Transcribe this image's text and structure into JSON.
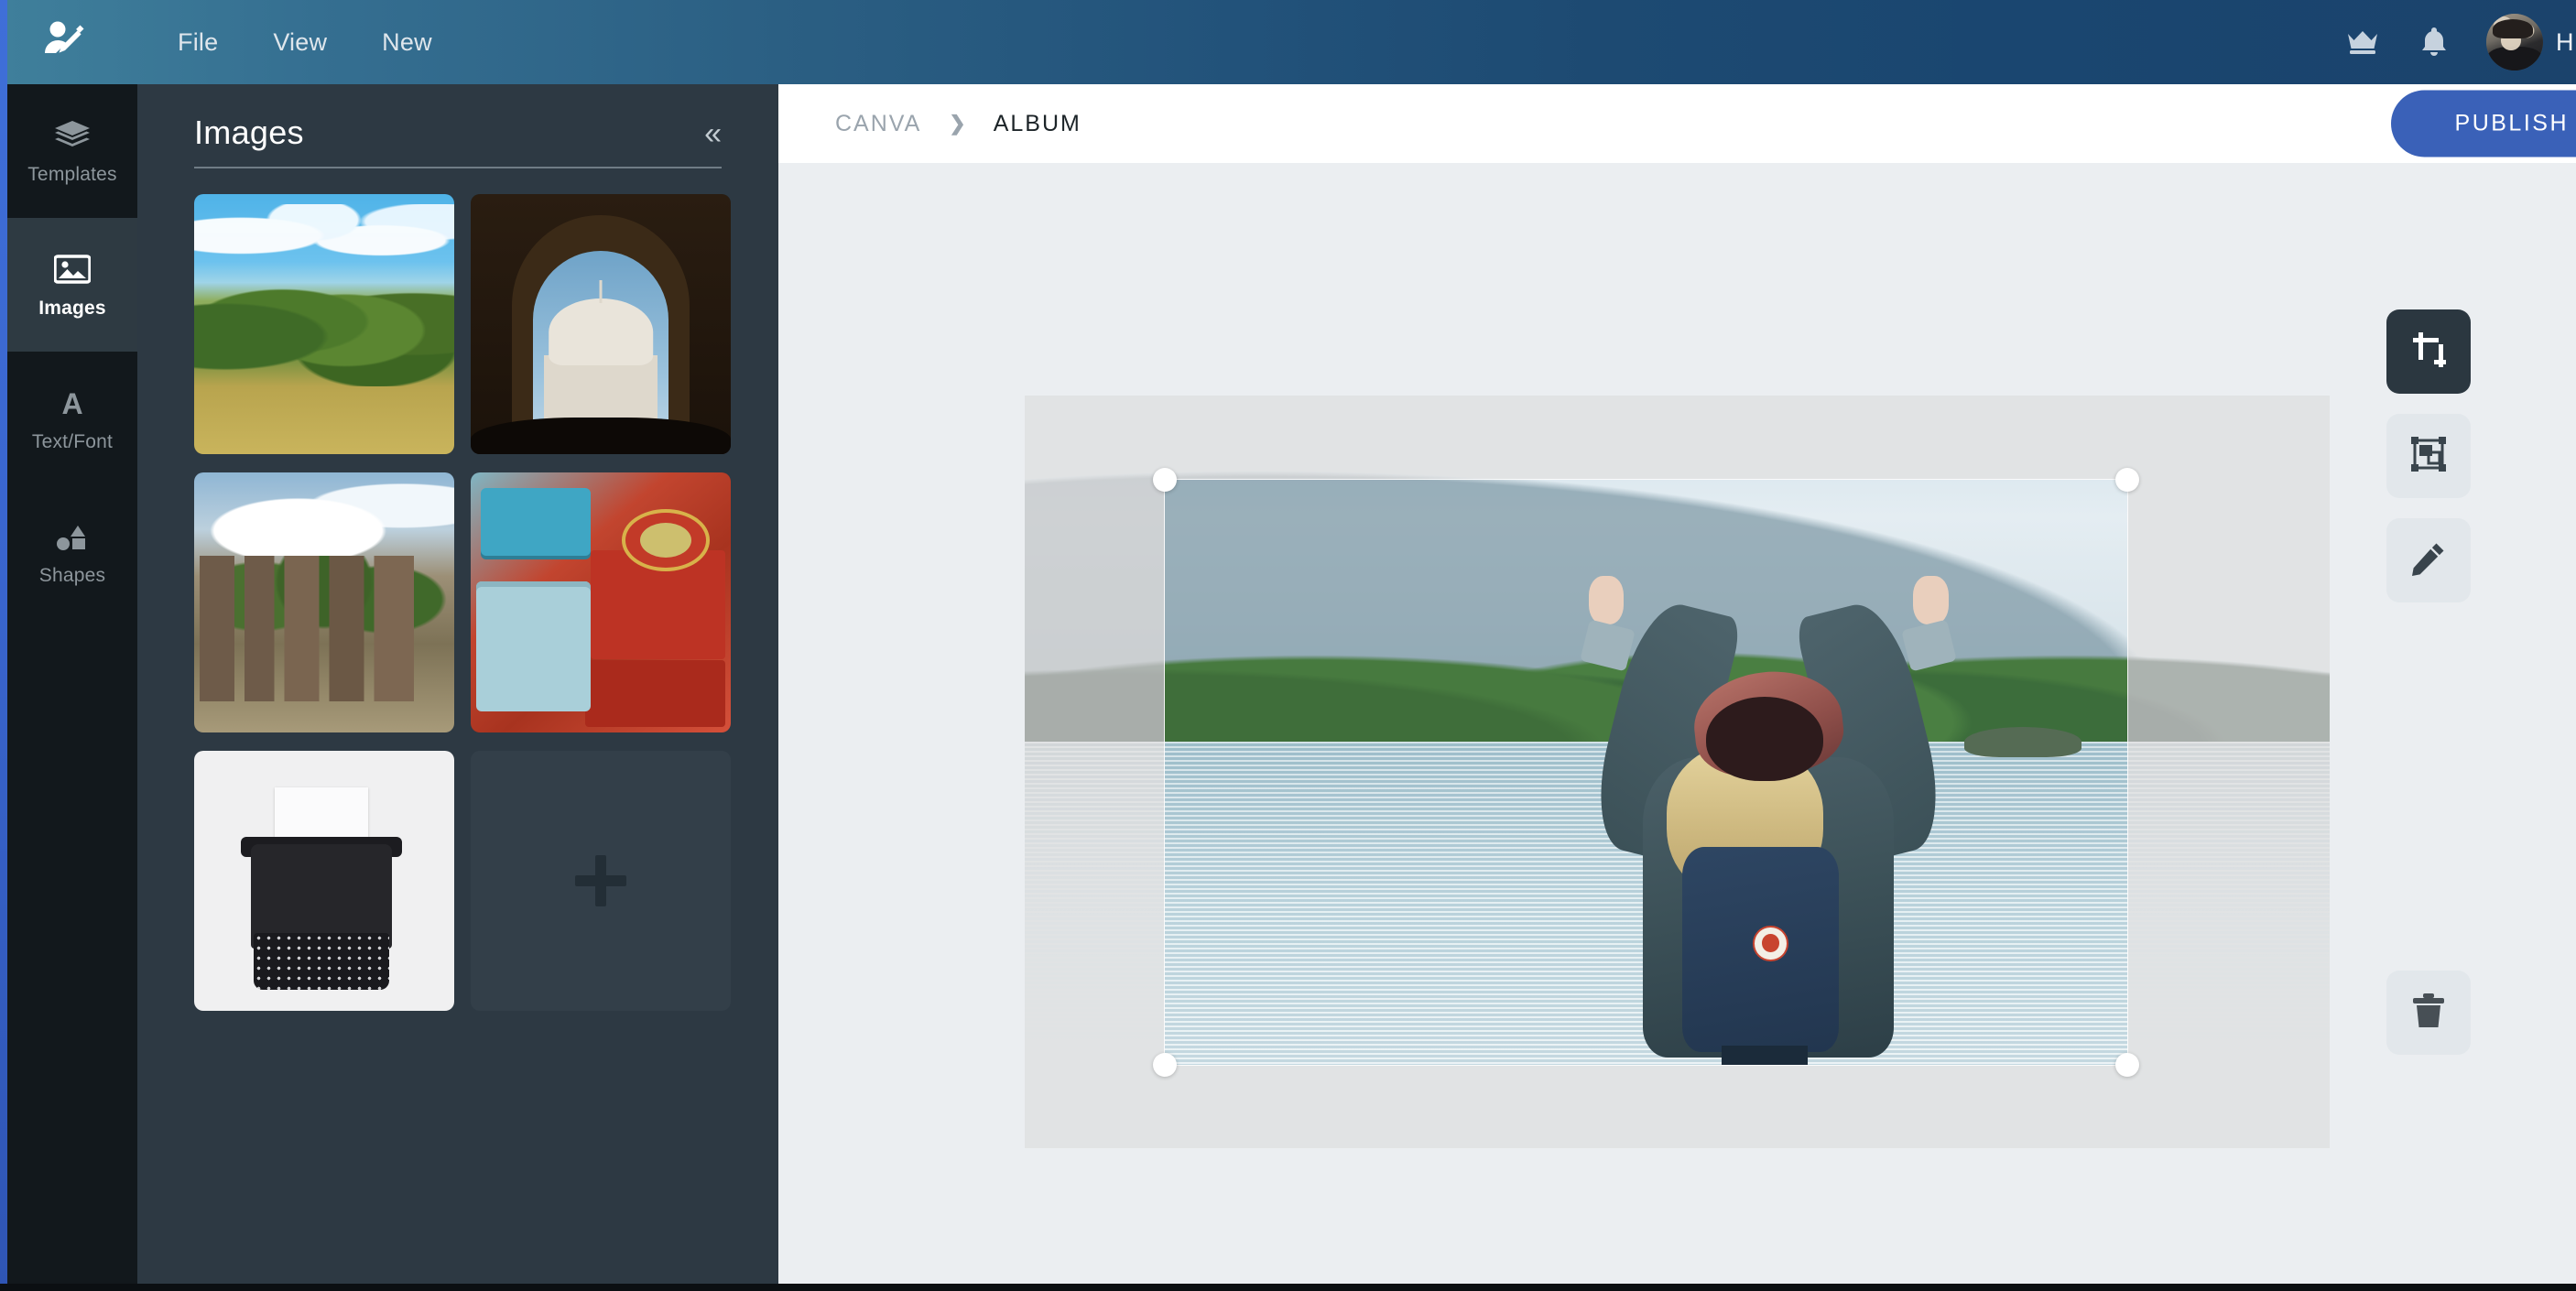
{
  "header": {
    "logo_icon": "user-edit-logo",
    "menu": [
      {
        "label": "File"
      },
      {
        "label": "View"
      },
      {
        "label": "New"
      }
    ],
    "crown_icon": "crown-icon",
    "bell_icon": "bell-icon",
    "avatar_alt": "user-avatar",
    "user_name": "H",
    "gradient_from": "#3f7f9b",
    "gradient_to": "#1b436c"
  },
  "rail": {
    "items": [
      {
        "label": "Templates",
        "icon": "layers-icon",
        "active": false
      },
      {
        "label": "Images",
        "icon": "image-icon",
        "active": true
      },
      {
        "label": "Text/Font",
        "icon": "letter-a-icon",
        "active": false
      },
      {
        "label": "Shapes",
        "icon": "shapes-icon",
        "active": false
      }
    ]
  },
  "panel": {
    "title": "Images",
    "collapse_icon": "double-chevron-left-icon",
    "thumbnails": [
      {
        "name": "forest-field-landscape",
        "art": "t-forest"
      },
      {
        "name": "taj-mahal-archway",
        "art": "t-taj"
      },
      {
        "name": "overgrown-ruins",
        "art": "t-ruins"
      },
      {
        "name": "vintage-tins",
        "art": "t-tins"
      },
      {
        "name": "vintage-typewriter",
        "art": "t-type"
      }
    ],
    "add_tile": {
      "icon": "plus-icon",
      "label": "+"
    }
  },
  "breadcrumb": {
    "root": "CANVA",
    "separator": "❯",
    "current": "ALBUM"
  },
  "actions": {
    "publish_label": "PUBLISH",
    "publish_color": "#3a61b8"
  },
  "canvas": {
    "image_alt": "woman-with-raised-arms-at-lake",
    "mode": "crop",
    "handles": [
      "top-left",
      "top-right",
      "bottom-left",
      "bottom-right"
    ]
  },
  "tools": [
    {
      "name": "crop-tool",
      "icon": "crop-icon",
      "active": true
    },
    {
      "name": "fit-tool",
      "icon": "transform-icon",
      "active": false
    },
    {
      "name": "edit-tool",
      "icon": "pencil-icon",
      "active": false
    }
  ],
  "trash": {
    "name": "delete-tool",
    "icon": "trash-icon"
  }
}
